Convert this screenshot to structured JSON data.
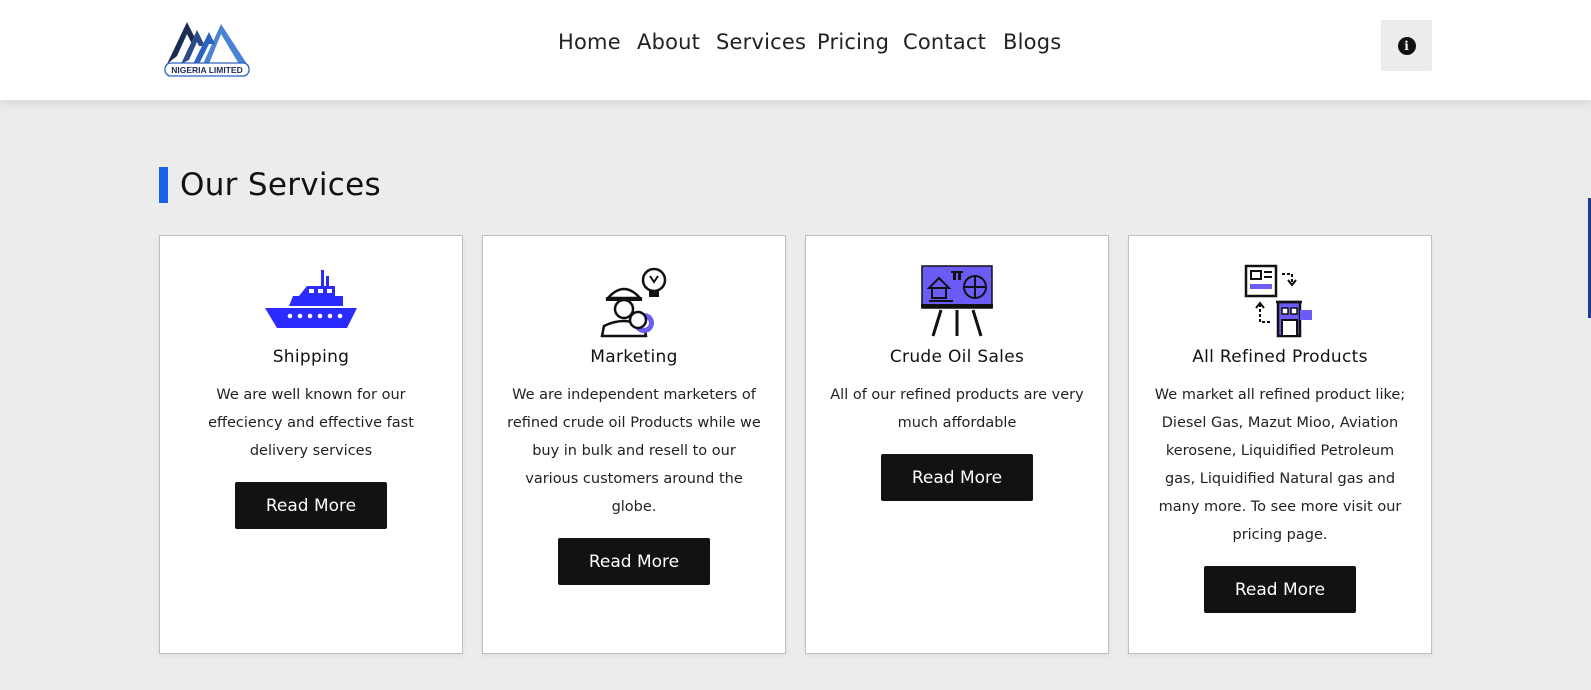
{
  "header": {
    "logo_text": "NIGERIA LIMITED",
    "nav": [
      "Home",
      "About",
      "Services",
      "Pricing",
      "Contact",
      "Blogs"
    ],
    "info_icon": "info-circle-icon"
  },
  "section": {
    "title": "Our Services"
  },
  "cards": [
    {
      "icon": "ship-icon",
      "title": "Shipping",
      "description": "We are well known for our effeciency and effective fast delivery services",
      "button": "Read More"
    },
    {
      "icon": "engineer-idea-icon",
      "title": "Marketing",
      "description": "We are independent marketers of refined crude oil Products while we buy in bulk and resell to our various customers around the globe.",
      "button": "Read More"
    },
    {
      "icon": "presentation-board-icon",
      "title": "Crude Oil Sales",
      "description": "All of our refined products are very much affordable",
      "button": "Read More"
    },
    {
      "icon": "exchange-documents-icon",
      "title": "All Refined Products",
      "description": "We market all refined product like; Diesel Gas, Mazut Mioo, Aviation kerosene, Liquidified Petroleum gas, Liquidified Natural gas and many more. To see more visit our pricing page.",
      "button": "Read More"
    }
  ],
  "colors": {
    "accent_blue": "#1763e8",
    "icon_blue": "#2b2bff",
    "icon_purple": "#6b5cf6",
    "button_bg": "#121212",
    "page_bg": "#ececec"
  }
}
